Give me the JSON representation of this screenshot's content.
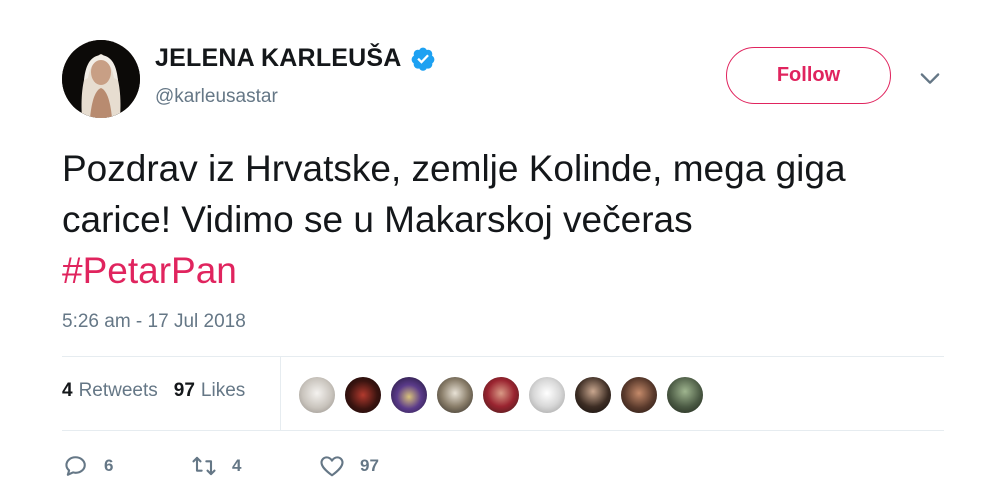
{
  "tweet": {
    "author": {
      "display_name": "JELENA KARLEUŠA",
      "handle": "@karleusastar",
      "verified": true
    },
    "follow_label": "Follow",
    "text_main": "Pozdrav iz Hrvatske, zemlje Kolinde, mega giga carice! Vidimo se u Makarskoj večeras",
    "hashtag": "#PetarPan",
    "timestamp": "5:26 am - 17 Jul 2018",
    "stats": {
      "retweets_count": "4",
      "retweets_label": "Retweets",
      "likes_count": "97",
      "likes_label": "Likes"
    },
    "actions": {
      "reply_count": "6",
      "retweet_count": "4",
      "like_count": "97"
    }
  },
  "colors": {
    "accent": "#e0245e",
    "verified": "#1da1f2",
    "secondary_text": "#657786",
    "divider": "#e6ecf0"
  },
  "icons": {
    "verified": "verified-badge-icon",
    "caret": "chevron-down-icon",
    "reply": "reply-icon",
    "retweet": "retweet-icon",
    "like": "heart-icon"
  },
  "likers_count": 9
}
